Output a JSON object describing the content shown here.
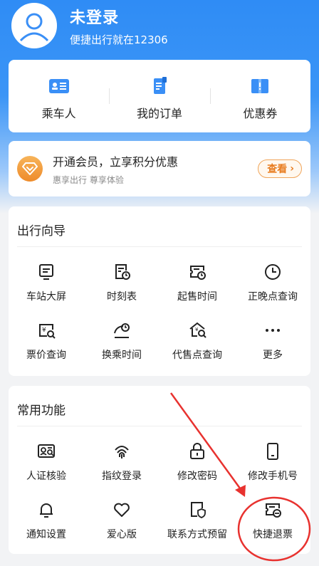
{
  "profile": {
    "name": "未登录",
    "subtitle": "便捷出行就在12306"
  },
  "quick_actions": [
    {
      "label": "乘车人",
      "icon": "passenger-icon"
    },
    {
      "label": "我的订单",
      "icon": "order-icon"
    },
    {
      "label": "优惠券",
      "icon": "coupon-icon"
    }
  ],
  "vip": {
    "title": "开通会员，立享积分优惠",
    "subtitle": "惠享出行 尊享体验",
    "button": "查看"
  },
  "travel_guide": {
    "title": "出行向导",
    "items": [
      {
        "label": "车站大屏",
        "icon": "station-screen-icon"
      },
      {
        "label": "时刻表",
        "icon": "timetable-icon"
      },
      {
        "label": "起售时间",
        "icon": "sale-time-icon"
      },
      {
        "label": "正晚点查询",
        "icon": "clock-icon"
      },
      {
        "label": "票价查询",
        "icon": "fare-query-icon"
      },
      {
        "label": "换乘时间",
        "icon": "transfer-time-icon"
      },
      {
        "label": "代售点查询",
        "icon": "agency-query-icon"
      },
      {
        "label": "更多",
        "icon": "more-icon"
      }
    ]
  },
  "common_functions": {
    "title": "常用功能",
    "items": [
      {
        "label": "人证核验",
        "icon": "id-verify-icon"
      },
      {
        "label": "指纹登录",
        "icon": "fingerprint-icon"
      },
      {
        "label": "修改密码",
        "icon": "lock-icon"
      },
      {
        "label": "修改手机号",
        "icon": "phone-icon"
      },
      {
        "label": "通知设置",
        "icon": "bell-icon"
      },
      {
        "label": "爱心版",
        "icon": "heart-icon"
      },
      {
        "label": "联系方式预留",
        "icon": "contact-shield-icon"
      },
      {
        "label": "快捷退票",
        "icon": "quick-refund-icon"
      }
    ]
  },
  "colors": {
    "brand_blue": "#3a8ff6",
    "vip_orange": "#ee8b2a",
    "annotation_red": "#e8322f"
  }
}
